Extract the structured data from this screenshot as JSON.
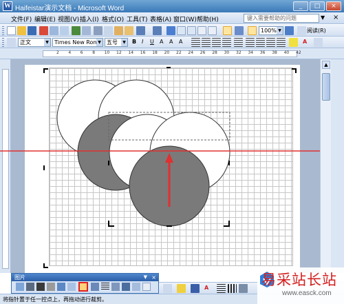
{
  "window": {
    "title": "Haifeistar演示文档 - Microsoft Word",
    "app_icon": "W"
  },
  "menu": {
    "items": [
      "文件(F)",
      "编辑(E)",
      "视图(V)",
      "插入(I)",
      "格式(O)",
      "工具(T)",
      "表格(A)",
      "窗口(W)",
      "帮助(H)"
    ],
    "help_placeholder": "键入需要帮助的问题",
    "close_doc": "×"
  },
  "toolbar": {
    "zoom": "100%",
    "reading": "阅读(R)"
  },
  "formatting": {
    "style": "正文",
    "font": "Times New Roman",
    "size": "五号"
  },
  "ruler": {
    "ticks": [
      "2",
      "4",
      "6",
      "8",
      "10",
      "12",
      "14",
      "16",
      "18",
      "20",
      "22",
      "24",
      "26",
      "28",
      "30",
      "32",
      "34",
      "36",
      "38",
      "40",
      "42"
    ]
  },
  "picture_toolbar": {
    "title": "图片",
    "close": "×"
  },
  "status": {
    "text": "将指针置于任一控点上，再拖动进行裁剪。"
  },
  "watermark": {
    "name": "易采站长站",
    "url": "www.easck.com"
  },
  "colors": {
    "accent": "#e03030",
    "shape_gray": "#7a7a7a",
    "selection": "#e02020"
  }
}
